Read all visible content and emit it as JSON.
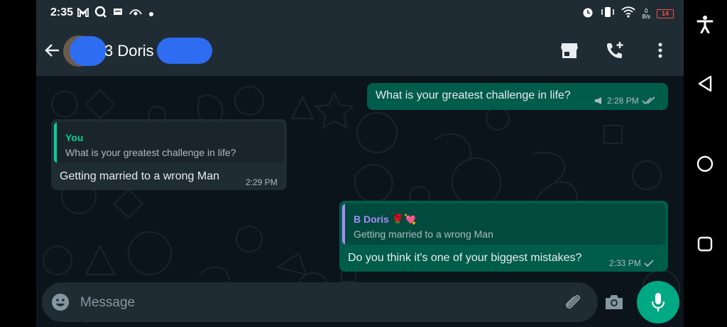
{
  "status_bar": {
    "time": "2:35",
    "battery": "14",
    "net_speed_value": "0",
    "net_speed_unit": "B/s"
  },
  "app_bar": {
    "contact_name": "B Doris",
    "contact_name_visible": "3 Doris"
  },
  "messages": [
    {
      "direction": "outgoing",
      "text": "What is your greatest challenge in life?",
      "time": "2:28 PM",
      "status": "read"
    },
    {
      "direction": "incoming",
      "reply_author": "You",
      "reply_text": "What is your greatest challenge in life?",
      "text": "Getting married to a wrong Man",
      "time": "2:29 PM"
    },
    {
      "direction": "outgoing",
      "reply_author": "B Doris 🌹💘",
      "reply_text": "Getting married to a wrong Man",
      "text": "Do you think it's one of your biggest mistakes?",
      "time": "2:33 PM",
      "status": "sent"
    }
  ],
  "composer": {
    "placeholder": "Message"
  },
  "colors": {
    "background": "#0b141a",
    "bar": "#1f2c34",
    "outgoing_bubble": "#005c4b",
    "incoming_bubble": "#1f2c34",
    "accent": "#00a884",
    "reply_you": "#06cf9c",
    "reply_contact": "#a78bfa"
  },
  "icons": {
    "back": "arrow-left-icon",
    "store": "storefront-icon",
    "add_call": "phone-add-icon",
    "menu": "more-vertical-icon",
    "emoji": "emoji-icon",
    "attach": "paperclip-icon",
    "camera": "camera-icon",
    "mic": "microphone-icon",
    "accessibility": "accessibility-icon",
    "nav_back": "triangle-back-icon",
    "nav_home": "circle-home-icon",
    "nav_recents": "square-recents-icon"
  }
}
